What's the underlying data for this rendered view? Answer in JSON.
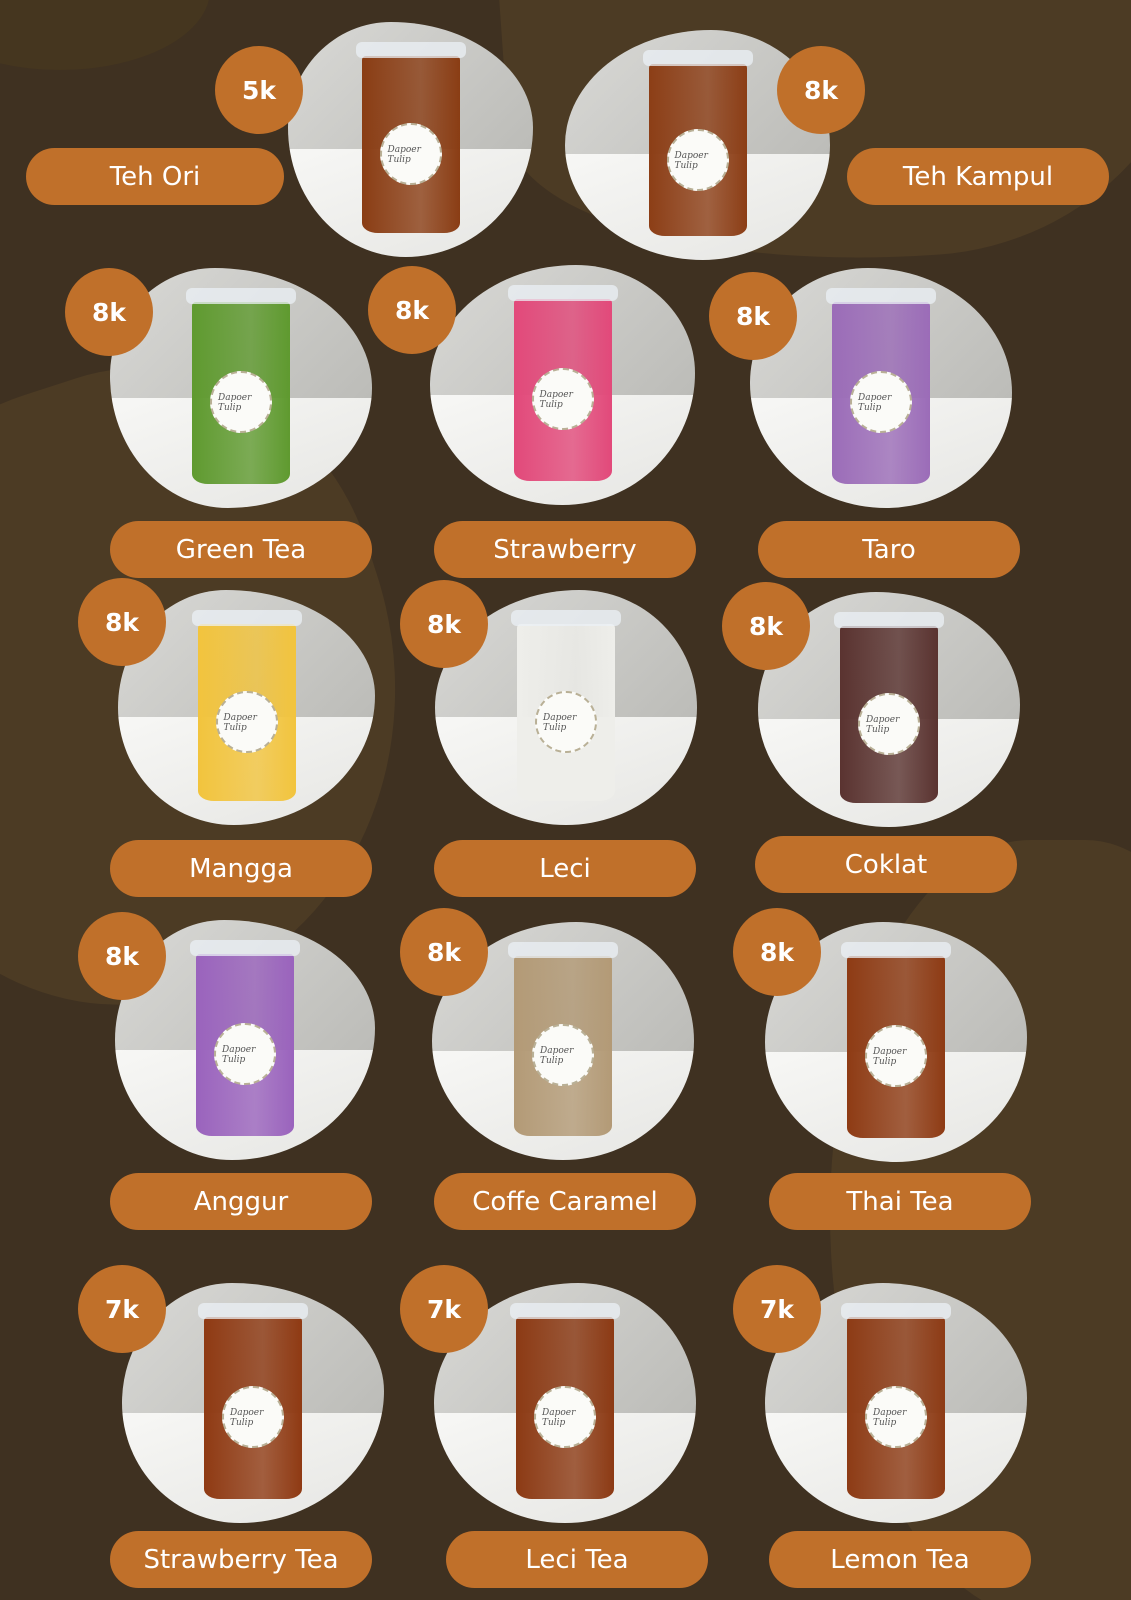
{
  "items": [
    {
      "name": "Teh Ori",
      "price": "5k",
      "drink_color": "#8a3d14"
    },
    {
      "name": "Teh Kampul",
      "price": "8k",
      "drink_color": "#8c3e16"
    },
    {
      "name": "Green Tea",
      "price": "8k",
      "drink_color": "#5f9a2f"
    },
    {
      "name": "Strawberry",
      "price": "8k",
      "drink_color": "#e2497a"
    },
    {
      "name": "Taro",
      "price": "8k",
      "drink_color": "#9b6cb8"
    },
    {
      "name": "Mangga",
      "price": "8k",
      "drink_color": "#f2c43d"
    },
    {
      "name": "Leci",
      "price": "8k",
      "drink_color": "#eeeeea"
    },
    {
      "name": "Coklat",
      "price": "8k",
      "drink_color": "#5a3330"
    },
    {
      "name": "Anggur",
      "price": "8k",
      "drink_color": "#9a63bd"
    },
    {
      "name": "Coffe Caramel",
      "price": "8k",
      "drink_color": "#b39a76"
    },
    {
      "name": "Thai Tea",
      "price": "8k",
      "drink_color": "#8e3b14"
    },
    {
      "name": "Strawberry Tea",
      "price": "7k",
      "drink_color": "#8f3a13"
    },
    {
      "name": "Leci Tea",
      "price": "7k",
      "drink_color": "#8c3a14"
    },
    {
      "name": "Lemon Tea",
      "price": "7k",
      "drink_color": "#8d3b15"
    }
  ]
}
